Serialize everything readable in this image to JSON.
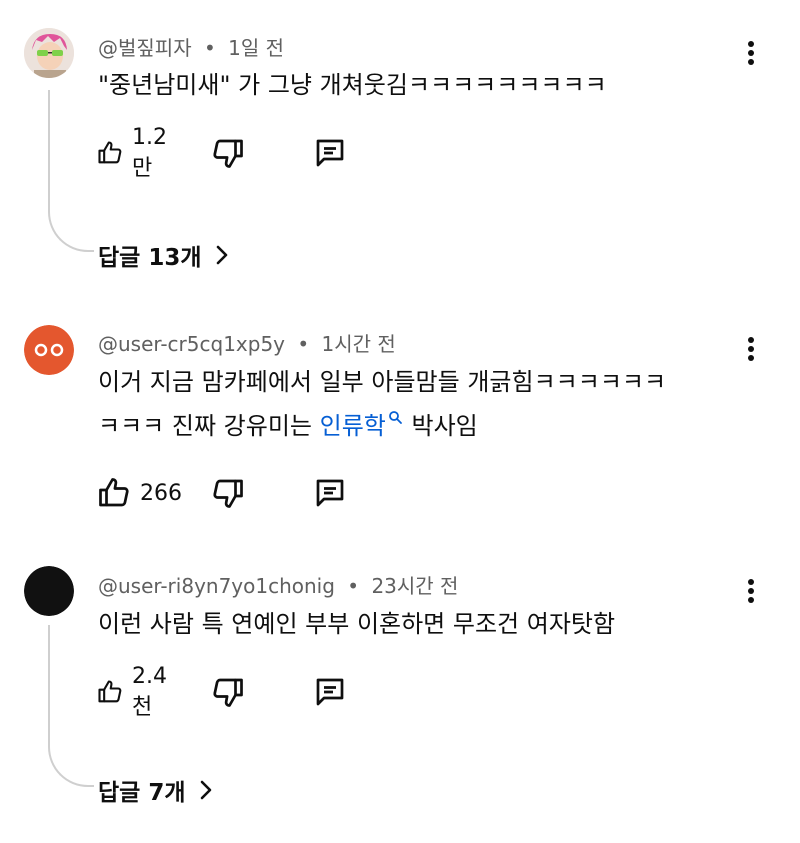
{
  "comments": [
    {
      "author": "@벌짚피자",
      "time": "1일 전",
      "text": "\"중년남미새\" 가 그냥 개쳐웃김ㅋㅋㅋㅋㅋㅋㅋㅋㅋ",
      "likes": "1.2만",
      "replies_label": "답글 13개"
    },
    {
      "author": "@user-cr5cq1xp5y",
      "time": "1시간 전",
      "text_line1": "이거 지금 맘카페에서 일부 아들맘들 개긁힘ㅋㅋㅋㅋㅋㅋ",
      "text_line2_before": "ㅋㅋㅋ 진짜 강유미는 ",
      "text_link": "인류학",
      "text_line2_after": " 박사임",
      "likes": "266"
    },
    {
      "author": "@user-ri8yn7yo1chonig",
      "time": "23시간 전",
      "text": "이런 사람 특 연예인 부부 이혼하면 무조건 여자탓함",
      "likes": "2.4천",
      "replies_label": "답글 7개"
    }
  ],
  "separator": "•",
  "colors": {
    "avatar2_bg": "#e4572e",
    "avatar3_bg": "#111111",
    "link": "#065fd4",
    "meta": "#606060"
  },
  "icons": [
    "like-icon",
    "dislike-icon",
    "reply-icon",
    "more-vert-icon",
    "chevron-right-icon",
    "search-icon"
  ]
}
